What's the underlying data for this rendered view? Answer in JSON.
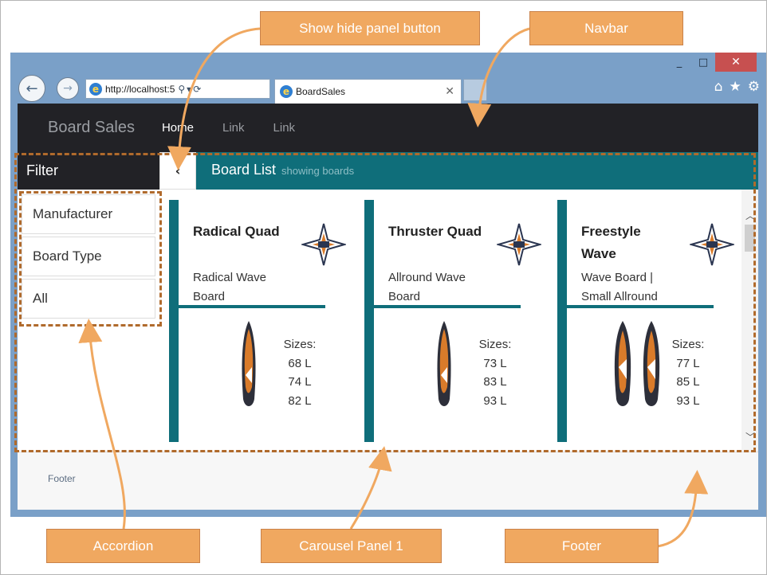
{
  "browser": {
    "url": "http://localhost:5",
    "tab_title": "BoardSales",
    "window_controls": [
      "_",
      "□",
      "✕"
    ],
    "tool_icons": [
      "home-icon",
      "star-icon",
      "gear-icon"
    ]
  },
  "navbar": {
    "brand": "Board Sales",
    "links": [
      {
        "label": "Home",
        "active": true
      },
      {
        "label": "Link",
        "active": false
      },
      {
        "label": "Link",
        "active": false
      }
    ]
  },
  "filter": {
    "title": "Filter",
    "items": [
      {
        "label": "Manufacturer"
      },
      {
        "label": "Board Type"
      },
      {
        "label": "All"
      }
    ]
  },
  "board_list": {
    "title": "Board List",
    "subtitle": "showing boards"
  },
  "cards": [
    {
      "title": "Radical Quad",
      "subtitle": "Radical Wave Board",
      "sizes_label": "Sizes:",
      "sizes": [
        "68 L",
        "74 L",
        "82 L"
      ],
      "board_count": 1
    },
    {
      "title": "Thruster Quad",
      "subtitle": "Allround Wave Board",
      "sizes_label": "Sizes:",
      "sizes": [
        "73 L",
        "83 L",
        "93 L"
      ],
      "board_count": 1
    },
    {
      "title": "Freestyle Wave",
      "subtitle": "Wave Board | Small Allround",
      "sizes_label": "Sizes:",
      "sizes": [
        "77 L",
        "85 L",
        "93 L"
      ],
      "board_count": 2
    }
  ],
  "footer": {
    "text": "Footer"
  },
  "callouts": {
    "show_hide": "Show hide panel button",
    "navbar": "Navbar",
    "accordion": "Accordion",
    "carousel": "Carousel Panel 1",
    "footer": "Footer"
  },
  "colors": {
    "teal": "#0f6e7a",
    "navbar_bg": "#222226",
    "callout": "#f0a860",
    "dash": "#b06a2c"
  }
}
